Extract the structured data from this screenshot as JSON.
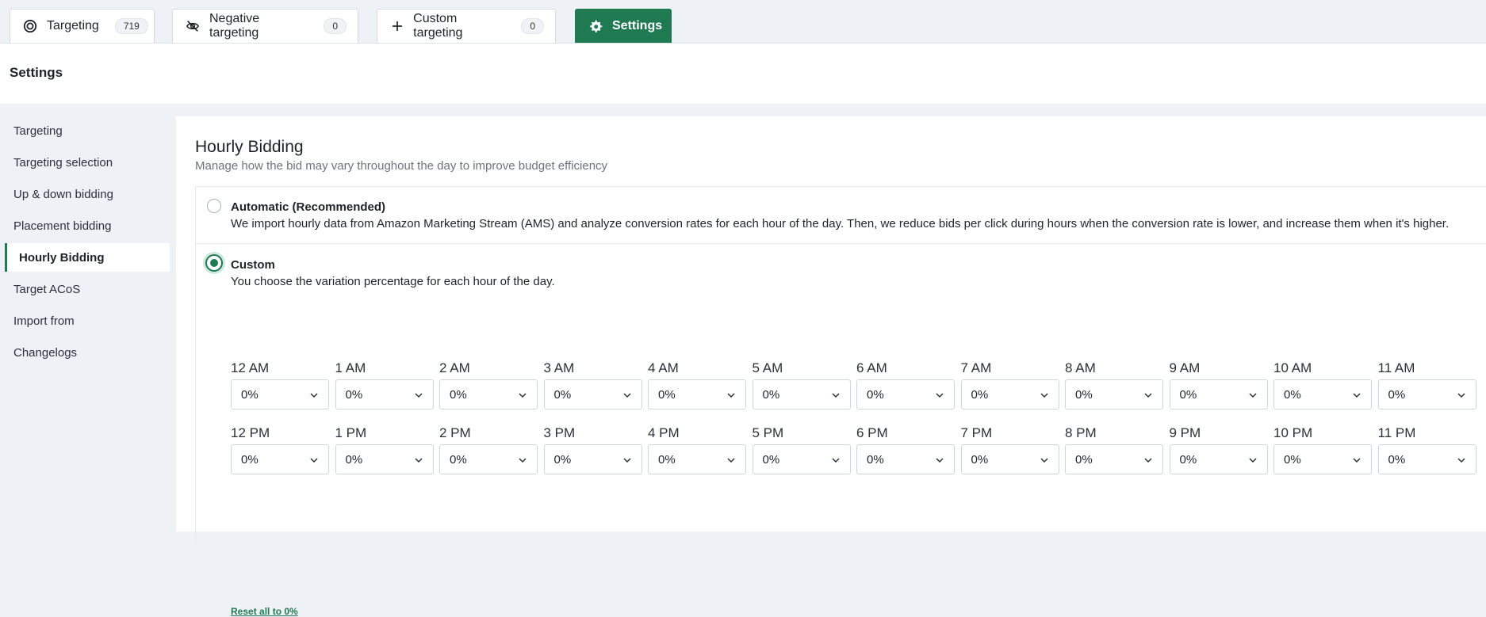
{
  "tabs": [
    {
      "label": "Targeting",
      "count": "719",
      "icon": "target-icon"
    },
    {
      "label": "Negative targeting",
      "count": "0",
      "icon": "eye-off-icon"
    },
    {
      "label": "Custom targeting",
      "count": "0",
      "icon": "plus-icon"
    },
    {
      "label": "Settings",
      "icon": "gear-icon",
      "active": true
    }
  ],
  "header": {
    "title": "Settings"
  },
  "sidebar": {
    "items": [
      {
        "label": "Targeting"
      },
      {
        "label": "Targeting selection"
      },
      {
        "label": "Up & down bidding"
      },
      {
        "label": "Placement bidding"
      },
      {
        "label": "Hourly Bidding",
        "active": true
      },
      {
        "label": "Target ACoS"
      },
      {
        "label": "Import from"
      },
      {
        "label": "Changelogs"
      }
    ]
  },
  "main": {
    "title": "Hourly Bidding",
    "subtitle": "Manage how the bid may vary throughout the day to improve budget efficiency",
    "options": [
      {
        "label": "Automatic (Recommended)",
        "description": "We import hourly data from Amazon Marketing Stream (AMS) and analyze conversion rates for each hour of the day. Then, we reduce bids per click during hours when the conversion rate is lower, and increase them when it's higher.",
        "selected": false
      },
      {
        "label": "Custom",
        "description": "You choose the variation percentage for each hour of the day.",
        "selected": true
      }
    ],
    "hours_am": [
      {
        "label": "12 AM",
        "value": "0%"
      },
      {
        "label": "1 AM",
        "value": "0%"
      },
      {
        "label": "2 AM",
        "value": "0%"
      },
      {
        "label": "3 AM",
        "value": "0%"
      },
      {
        "label": "4 AM",
        "value": "0%"
      },
      {
        "label": "5 AM",
        "value": "0%"
      },
      {
        "label": "6 AM",
        "value": "0%"
      },
      {
        "label": "7 AM",
        "value": "0%"
      },
      {
        "label": "8 AM",
        "value": "0%"
      },
      {
        "label": "9 AM",
        "value": "0%"
      },
      {
        "label": "10 AM",
        "value": "0%"
      },
      {
        "label": "11 AM",
        "value": "0%"
      }
    ],
    "hours_pm": [
      {
        "label": "12 PM",
        "value": "0%"
      },
      {
        "label": "1 PM",
        "value": "0%"
      },
      {
        "label": "2 PM",
        "value": "0%"
      },
      {
        "label": "3 PM",
        "value": "0%"
      },
      {
        "label": "4 PM",
        "value": "0%"
      },
      {
        "label": "5 PM",
        "value": "0%"
      },
      {
        "label": "6 PM",
        "value": "0%"
      },
      {
        "label": "7 PM",
        "value": "0%"
      },
      {
        "label": "8 PM",
        "value": "0%"
      },
      {
        "label": "9 PM",
        "value": "0%"
      },
      {
        "label": "10 PM",
        "value": "0%"
      },
      {
        "label": "11 PM",
        "value": "0%"
      }
    ],
    "reset_label": "Reset all to 0%"
  },
  "colors": {
    "accent": "#1f7a52",
    "sidebar_bg": "#eef1f6"
  }
}
